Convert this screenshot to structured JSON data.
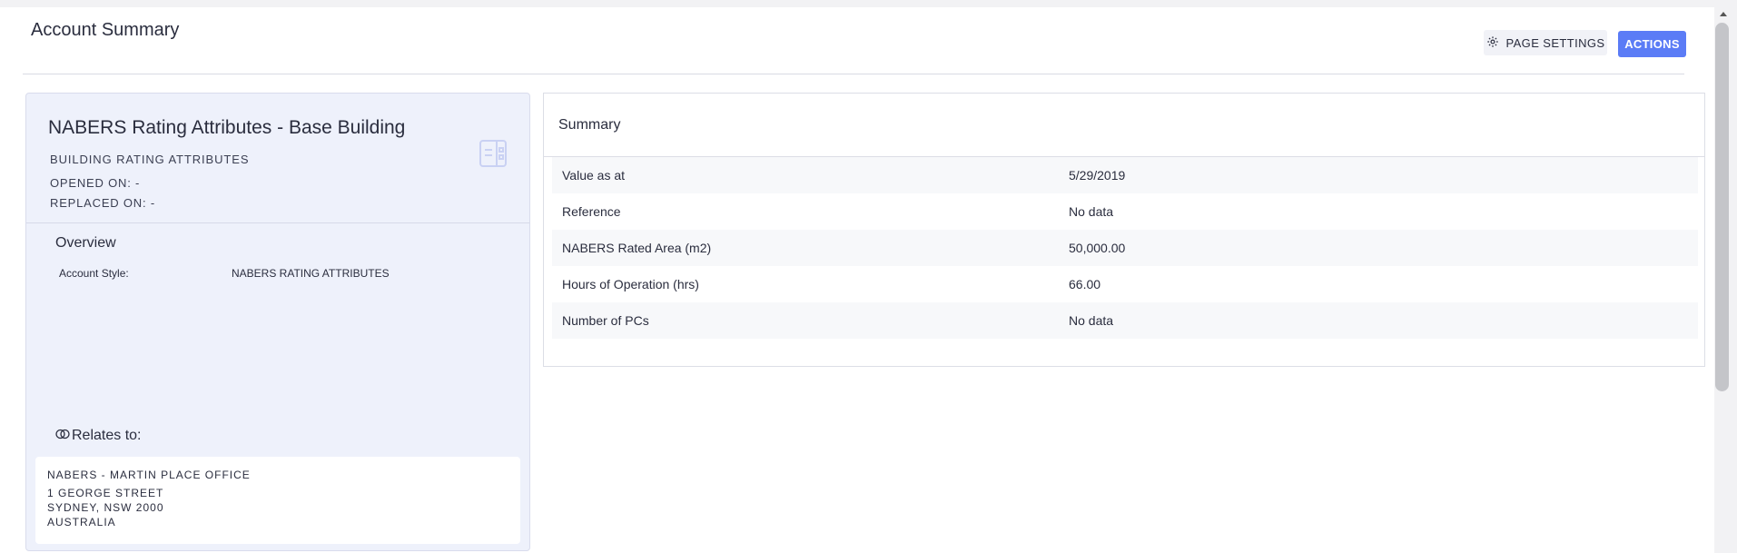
{
  "header": {
    "title": "Account Summary",
    "page_settings_label": "PAGE SETTINGS",
    "actions_label": "ACTIONS"
  },
  "account_card": {
    "title": "NABERS Rating Attributes - Base Building",
    "subtitle": "BUILDING RATING ATTRIBUTES",
    "opened_on": "OPENED ON: -",
    "replaced_on": "REPLACED ON: -",
    "icon": "account-card-icon",
    "overview": {
      "heading": "Overview",
      "account_style_label": "Account Style:",
      "account_style_value": "NABERS RATING ATTRIBUTES"
    },
    "relates_to": {
      "heading": "Relates to:",
      "icon": "link-rings-icon",
      "name": "NABERS - MARTIN PLACE OFFICE",
      "address_line1": "1 GEORGE STREET",
      "address_line2": "SYDNEY, NSW 2000",
      "address_line3": "AUSTRALIA"
    }
  },
  "summary": {
    "heading": "Summary",
    "rows": [
      {
        "label": "Value as at",
        "value": "5/29/2019"
      },
      {
        "label": "Reference",
        "value": "No data"
      },
      {
        "label": "NABERS Rated Area (m2)",
        "value": "50,000.00"
      },
      {
        "label": "Hours of Operation (hrs)",
        "value": "66.00"
      },
      {
        "label": "Number of PCs",
        "value": "No data"
      }
    ]
  },
  "colors": {
    "accent": "#5b7cf6",
    "card_background": "#eef1fb",
    "text": "#2a2d3e"
  }
}
